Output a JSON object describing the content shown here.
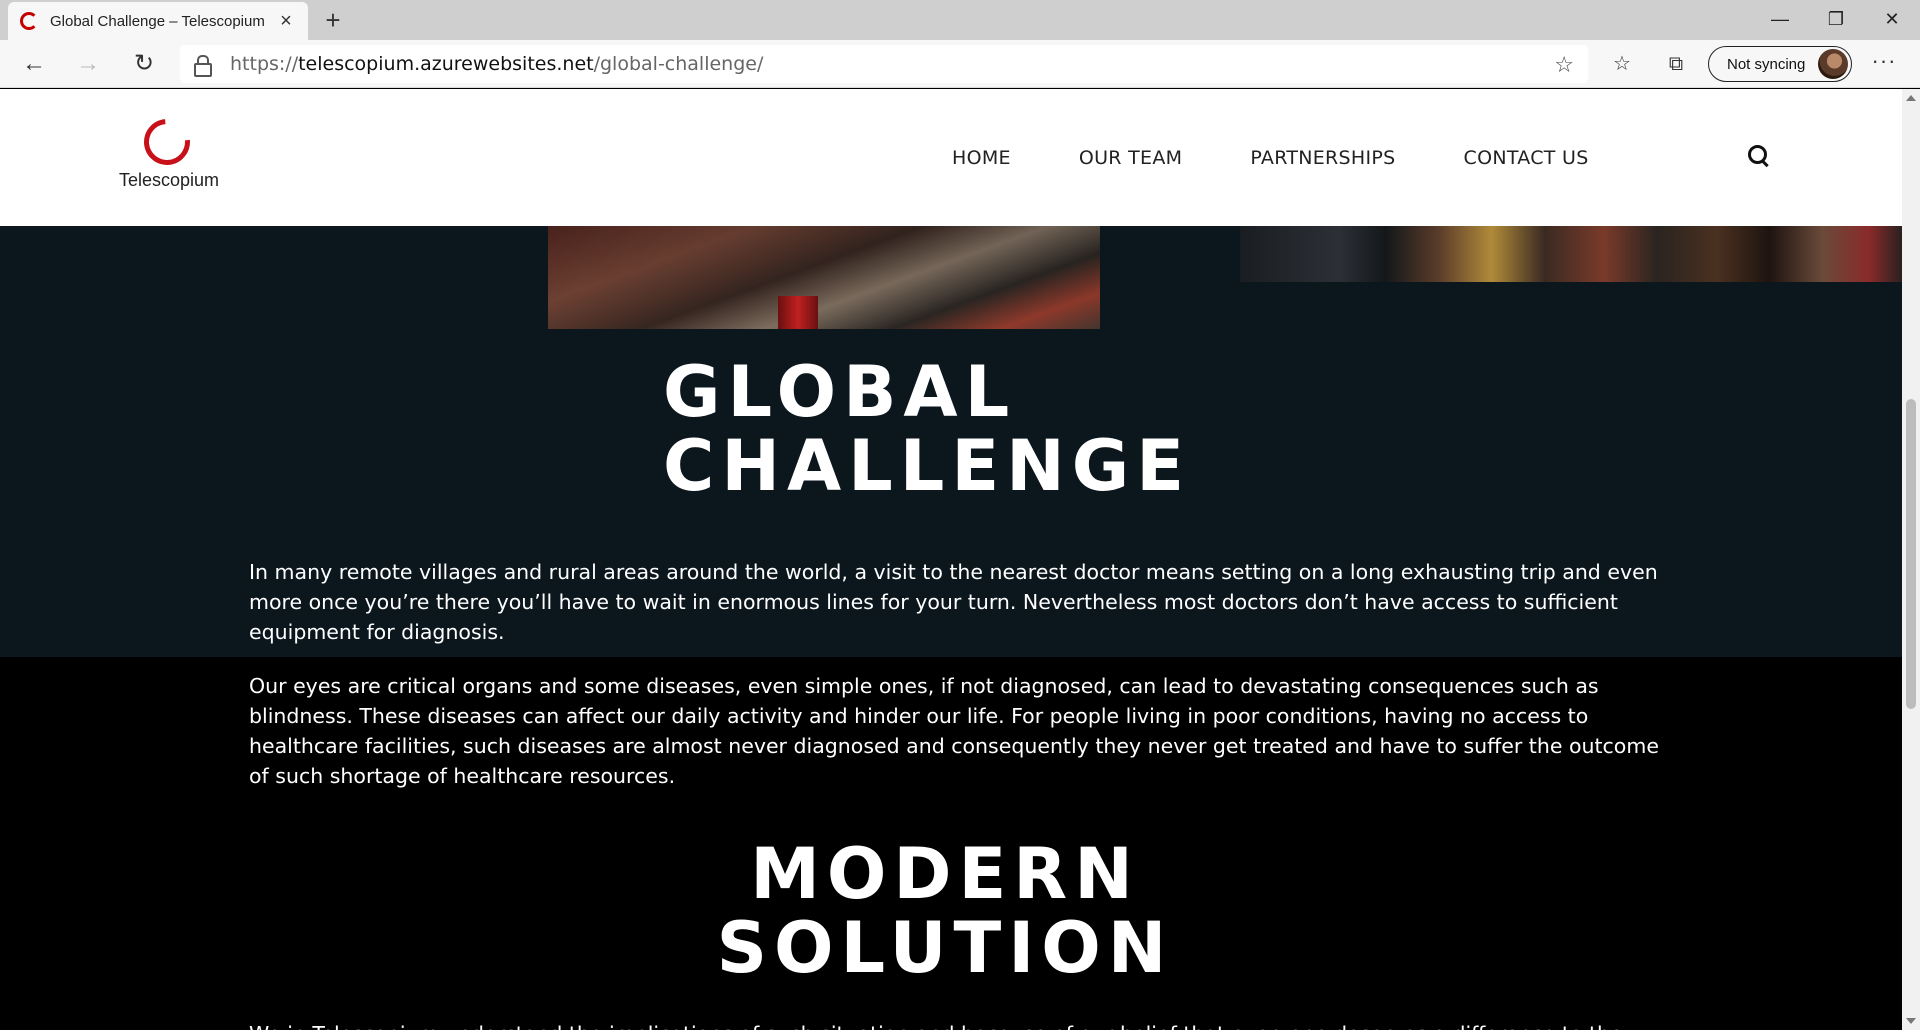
{
  "browser": {
    "tab_title": "Global Challenge – Telescopium",
    "url_prefix": "https://",
    "url_host": "telescopium.azurewebsites.net",
    "url_path": "/global-challenge/",
    "sync_label": "Not syncing"
  },
  "site": {
    "logo_text": "Telescopium",
    "nav": [
      "HOME",
      "OUR TEAM",
      "PARTNERSHIPS",
      "CONTACT US"
    ]
  },
  "content": {
    "heading1_line1": "GLOBAL",
    "heading1_line2": "CHALLENGE",
    "para1": "In many remote villages and rural areas around the world, a visit to the nearest doctor means setting on a long exhausting trip  and even more once you’re there you’ll have to wait in enormous lines for your turn. Nevertheless most doctors don’t have access to sufficient equipment for diagnosis.",
    "para2": "Our eyes are critical organs and some diseases, even simple ones, if not diagnosed, can lead to devastating consequences such as blindness. These diseases can affect our daily activity and hinder our life.  For people living in poor conditions, having no access to healthcare facilities, such diseases are almost never diagnosed and consequently they never get treated and have to suffer the outcome of such shortage of healthcare resources.",
    "heading2_line1": "MODERN",
    "heading2_line2": "SOLUTION",
    "para3_partial": "We in Telescopium understand the implications of such situation and because of our belief that everyone deserves a difference to the"
  },
  "colors": {
    "brand_red": "#c8101a",
    "dark_band": "#0b171d",
    "page_bg": "#000000"
  }
}
